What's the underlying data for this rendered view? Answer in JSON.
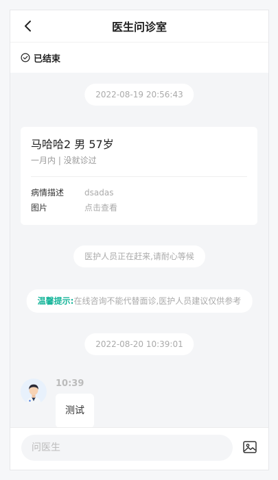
{
  "header": {
    "title": "医生问诊室"
  },
  "status": {
    "label": "已结束"
  },
  "timestamps": [
    "2022-08-19 20:56:43",
    "2022-08-20 10:39:01"
  ],
  "patient_card": {
    "patient": "马哈哈2 男 57岁",
    "history": "一月内 | 没就诊过",
    "rows": [
      {
        "key": "病情描述",
        "value": "dsadas"
      },
      {
        "key": "图片",
        "value": "点击查看"
      }
    ]
  },
  "notice": "医护人员正在赶来,请耐心等候",
  "tip": {
    "title": "温馨提示:",
    "text": "在线咨询不能代替面诊,医护人员建议仅供参考"
  },
  "message": {
    "time": "10:39",
    "text": "测试",
    "avatar_icon": "doctor-avatar"
  },
  "input": {
    "placeholder": "问医生"
  },
  "icons": {
    "back": "chevron-left-icon",
    "status": "check-circle-icon",
    "image": "image-icon"
  },
  "colors": {
    "accent": "#17b59a",
    "background": "#f4f5f7"
  }
}
